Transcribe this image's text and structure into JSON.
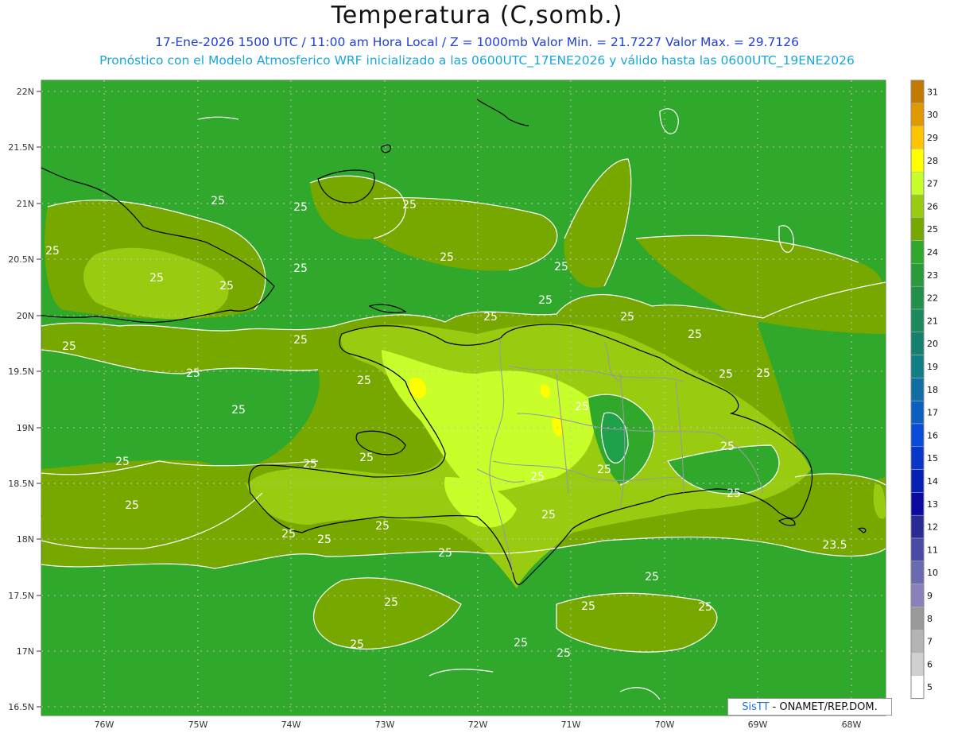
{
  "title": "Temperatura (C,somb.)",
  "subtitle_1": "17-Ene-2026 1500 UTC / 11:00 am Hora Local / Z = 1000mb   Valor Min. = 21.7227  Valor Max. = 29.7126",
  "subtitle_2": "Pronóstico con el Modelo Atmosferico WRF inicializado a las 0600UTC_17ENE2026 y válido hasta las  0600UTC_19ENE2026",
  "credit": {
    "brand": "SisTT",
    "org": "- ONAMET/REP.DOM."
  },
  "lat_labels": [
    "22N",
    "21.5N",
    "21N",
    "20.5N",
    "20N",
    "19.5N",
    "19N",
    "18.5N",
    "18N",
    "17.5N",
    "17N",
    "16.5N"
  ],
  "lon_labels": [
    "76W",
    "75W",
    "74W",
    "73W",
    "72W",
    "71W",
    "70W",
    "69W",
    "68W"
  ],
  "contour_labels": [
    "25",
    "25",
    "25",
    "25",
    "25",
    "25",
    "25",
    "25",
    "25",
    "25",
    "25",
    "25",
    "25",
    "25",
    "25",
    "25",
    "25",
    "25",
    "25",
    "25",
    "25",
    "25",
    "25",
    "25",
    "25",
    "25",
    "25",
    "25",
    "25",
    "25",
    "25",
    "25",
    "23.5",
    "25",
    "25",
    "25",
    "25",
    "25",
    "25",
    "25",
    "25",
    "25"
  ],
  "colorbar": {
    "levels": [
      "31",
      "30",
      "29",
      "28",
      "27",
      "26",
      "25",
      "24",
      "23",
      "22",
      "21",
      "20",
      "19",
      "18",
      "17",
      "16",
      "15",
      "14",
      "13",
      "12",
      "11",
      "10",
      "9",
      "8",
      "7",
      "6",
      "5"
    ],
    "colors": [
      "#c47a00",
      "#e09a00",
      "#ffc400",
      "#ffff00",
      "#c8ff2a",
      "#99cc11",
      "#77a800",
      "#2fa82c",
      "#2a9a3a",
      "#21904a",
      "#1a8a5c",
      "#15806e",
      "#117e86",
      "#0f6fa3",
      "#0a5fbf",
      "#0a4ad8",
      "#0836c8",
      "#0520b4",
      "#0a0aa0",
      "#2a2a96",
      "#4a4aa6",
      "#6a6ab0",
      "#8a80bb",
      "#9a9a9a",
      "#b4b4b4",
      "#d0d0d0",
      "#ffffff"
    ]
  },
  "map_colors": {
    "base": "#77a800",
    "c24": "#2fa82c",
    "c23": "#1fa04a",
    "c26": "#99cc11",
    "c27": "#c8ff2a",
    "c28": "#ffff00",
    "contour": "#ffffff",
    "coast": "#000000",
    "border": "#999999",
    "grid": "#aaaaaa"
  }
}
